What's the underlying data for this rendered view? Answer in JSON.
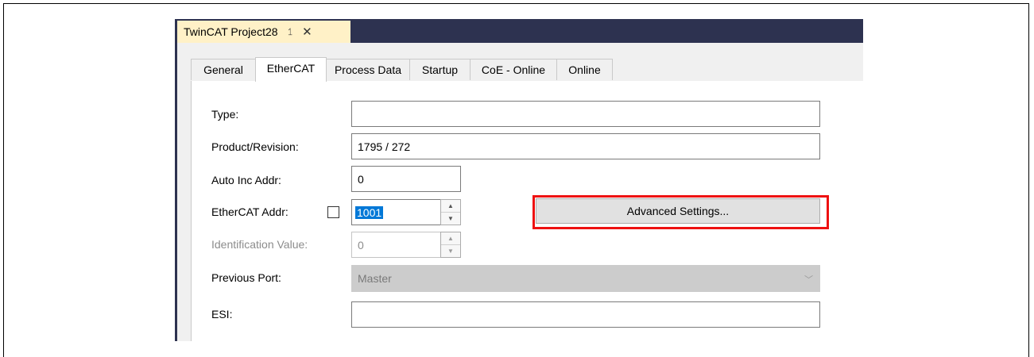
{
  "document_tab": {
    "title": "TwinCAT Project28",
    "pin_glyph": "⥠",
    "close_glyph": "✕"
  },
  "tabs": [
    {
      "label": "General"
    },
    {
      "label": "EtherCAT"
    },
    {
      "label": "Process Data"
    },
    {
      "label": "Startup"
    },
    {
      "label": "CoE - Online"
    },
    {
      "label": "Online"
    }
  ],
  "form": {
    "type": {
      "label": "Type:",
      "value": ""
    },
    "product_revision": {
      "label": "Product/Revision:",
      "value": "1795 / 272"
    },
    "auto_inc_addr": {
      "label": "Auto Inc Addr:",
      "value": "0"
    },
    "ethercat_addr": {
      "label": "EtherCAT Addr:",
      "value": "1001",
      "checked": false
    },
    "identification_value": {
      "label": "Identification Value:",
      "value": "0"
    },
    "previous_port": {
      "label": "Previous Port:",
      "value": "Master"
    },
    "esi": {
      "label": "ESI:",
      "value": ""
    }
  },
  "buttons": {
    "advanced_settings": "Advanced Settings..."
  },
  "colors": {
    "title_bar": "#2d3250",
    "doc_tab": "#fff1c7",
    "highlight": "#ee1111",
    "selection": "#0078d7"
  }
}
